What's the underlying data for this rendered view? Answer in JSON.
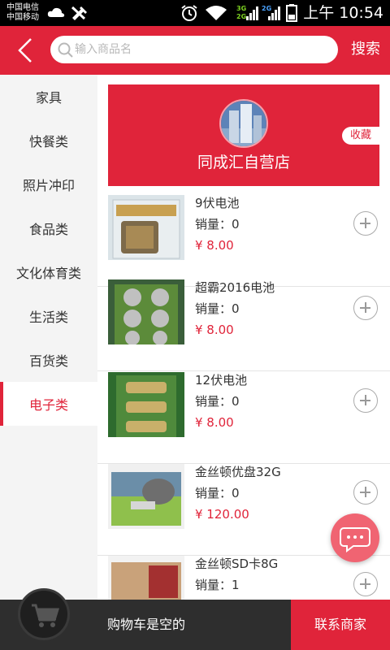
{
  "status_bar": {
    "carrier_1": "中国电信",
    "carrier_2": "中国移动",
    "network_1": "3G",
    "network_2": "2G",
    "network_3": "2G",
    "time": "上午 10:54"
  },
  "header": {
    "search_placeholder": "输入商品名",
    "search_label": "搜索"
  },
  "sidebar": {
    "items": [
      {
        "label": "家具"
      },
      {
        "label": "快餐类"
      },
      {
        "label": "照片冲印"
      },
      {
        "label": "食品类"
      },
      {
        "label": "文化体育类"
      },
      {
        "label": "生活类"
      },
      {
        "label": "百货类"
      },
      {
        "label": "电子类",
        "active": true
      }
    ]
  },
  "shop": {
    "name": "同成汇自营店",
    "favorite_label": "收藏"
  },
  "products": [
    {
      "name": "9伏电池",
      "sales_label": "销量：",
      "sales": "0",
      "price": "¥ 8.00"
    },
    {
      "name": "超霸2016电池",
      "sales_label": "销量：",
      "sales": "0",
      "price": "¥ 8.00"
    },
    {
      "name": "12伏电池",
      "sales_label": "销量：",
      "sales": "0",
      "price": "¥ 8.00"
    },
    {
      "name": "金丝顿优盘32G",
      "sales_label": "销量：",
      "sales": "0",
      "price": "¥ 120.00"
    },
    {
      "name": "金丝顿SD卡8G",
      "sales_label": "销量：",
      "sales": "1",
      "price": ""
    }
  ],
  "cart": {
    "empty_label": "购物车是空的",
    "contact_label": "联系商家"
  },
  "colors": {
    "accent": "#e0243a",
    "bottom_bar": "#2e2e2e"
  }
}
